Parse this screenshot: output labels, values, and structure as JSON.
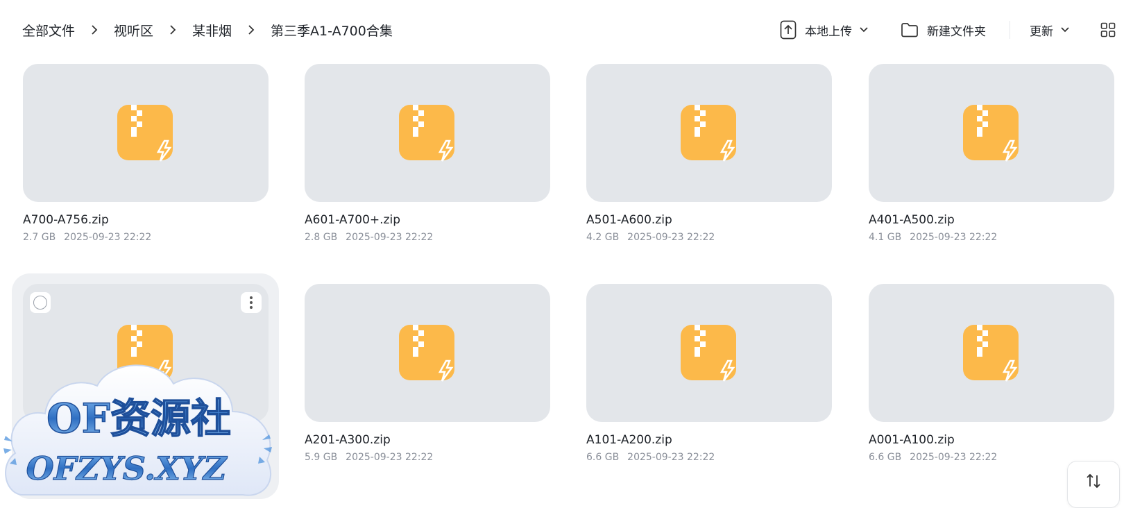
{
  "breadcrumb": [
    "全部文件",
    "视听区",
    "某非烟",
    "第三季A1-A700合集"
  ],
  "toolbar": {
    "upload_label": "本地上传",
    "new_folder_label": "新建文件夹",
    "sort_label": "更新"
  },
  "files": [
    {
      "name": "A700-A756.zip",
      "size": "2.7 GB",
      "date": "2025-09-23 22:22"
    },
    {
      "name": "A601-A700+.zip",
      "size": "2.8 GB",
      "date": "2025-09-23 22:22"
    },
    {
      "name": "A501-A600.zip",
      "size": "4.2 GB",
      "date": "2025-09-23 22:22"
    },
    {
      "name": "A401-A500.zip",
      "size": "4.1 GB",
      "date": "2025-09-23 22:22"
    },
    {
      "name": "",
      "size": "",
      "date": ""
    },
    {
      "name": "A201-A300.zip",
      "size": "5.9 GB",
      "date": "2025-09-23 22:22"
    },
    {
      "name": "A101-A200.zip",
      "size": "6.6 GB",
      "date": "2025-09-23 22:22"
    },
    {
      "name": "A001-A100.zip",
      "size": "6.6 GB",
      "date": "2025-09-23 22:22"
    }
  ],
  "watermark": {
    "line1": "OF资源社",
    "line2": "OFZYS.XYZ"
  },
  "colors": {
    "accent_zip": "#fcb94a",
    "thumb_bg": "#e3e6ea",
    "meta": "#8a8f99"
  }
}
